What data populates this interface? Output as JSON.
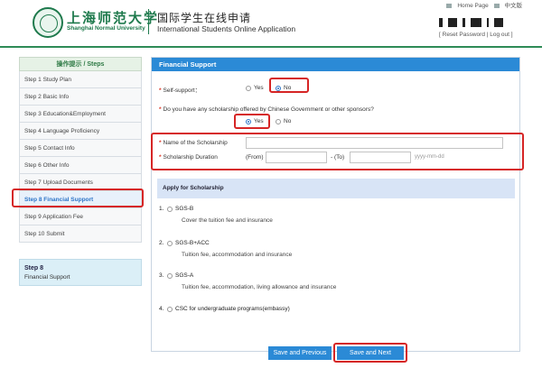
{
  "header": {
    "university_cn": "上海师范大学",
    "university_en": "Shanghai Normal University",
    "app_cn": "国际学生在线申请",
    "app_en": "International Students Online Application",
    "home_link": "Home Page",
    "lang_link": "中文版",
    "reset_password": "Reset Password",
    "log_out": "Log out",
    "brand_color": "#1f7a4d"
  },
  "sidebar": {
    "header": "操作提示 / Steps",
    "items": [
      {
        "label": "Step 1 Study Plan"
      },
      {
        "label": "Step 2 Basic Info"
      },
      {
        "label": "Step 3 Education&Employment"
      },
      {
        "label": "Step 4 Language Proficiency"
      },
      {
        "label": "Step 5 Contact Info"
      },
      {
        "label": "Step 6 Other Info"
      },
      {
        "label": "Step 7 Upload Documents"
      },
      {
        "label": "Step 8 Financial Support"
      },
      {
        "label": "Step 9 Application Fee"
      },
      {
        "label": "Step 10 Submit"
      }
    ],
    "active_index": 7,
    "current_box": {
      "step": "Step 8",
      "name": "Financial Support"
    }
  },
  "form": {
    "title": "Financial Support",
    "self_support": {
      "label": "Self-support：",
      "yes": "Yes",
      "no": "No",
      "selected": "No"
    },
    "scholarship_question": {
      "label": "Do you have any scholarship offered by Chinese Government or other sponsors?",
      "yes": "Yes",
      "no": "No",
      "selected": "Yes"
    },
    "scholarship_name": {
      "label": "Name of the Scholarship",
      "value": ""
    },
    "scholarship_duration": {
      "label": "Scholarship Duration",
      "from_label": "(From)",
      "to_label": "- (To)",
      "from_value": "",
      "to_value": "",
      "date_hint": "yyyy-mm-dd"
    },
    "apply_title": "Apply for Scholarship",
    "options": [
      {
        "number": "1.",
        "name": "SGS-B",
        "desc": "Cover the tuition fee and insurance"
      },
      {
        "number": "2.",
        "name": "SGS-B+ACC",
        "desc": "Tuition fee, accommodation and insurance"
      },
      {
        "number": "3.",
        "name": "SGS-A",
        "desc": "Tuition fee, accommodation, living allowance and insurance"
      },
      {
        "number": "4.",
        "name": "CSC for undergraduate programs(embassy)",
        "desc": ""
      }
    ],
    "buttons": {
      "previous": "Save and Previous",
      "next": "Save and Next"
    }
  },
  "colors": {
    "accent": "#2b8ad6",
    "highlight": "#d62525",
    "header_rule": "#2e8b57"
  }
}
